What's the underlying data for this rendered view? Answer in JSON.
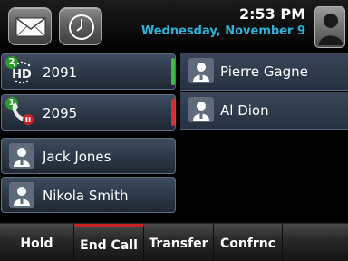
{
  "status_bar": {
    "time": "2:53 PM",
    "date": "Wednesday, November 9",
    "icons": {
      "messages": "envelope-icon",
      "clock": "clock-icon",
      "user": "person-icon"
    }
  },
  "lines": [
    {
      "label": "2091",
      "badge": "2",
      "icon": "hd-phone-icon",
      "status": "active",
      "status_color": "#37c23c"
    },
    {
      "label": "2095",
      "badge": "1",
      "icon": "held-call-icon",
      "status": "held",
      "status_color": "#e02929"
    }
  ],
  "contacts_left": [
    {
      "label": "Jack Jones",
      "icon": "person-icon"
    },
    {
      "label": "Nikola Smith",
      "icon": "person-icon"
    }
  ],
  "contacts_right": [
    {
      "label": "Pierre Gagne",
      "icon": "person-icon"
    },
    {
      "label": "Al Dion",
      "icon": "person-icon"
    }
  ],
  "softkeys": [
    {
      "label": "Hold"
    },
    {
      "label": "End Call",
      "highlight": "#c42424"
    },
    {
      "label": "Transfer"
    },
    {
      "label": "Confrnc"
    },
    {
      "label": ""
    }
  ]
}
